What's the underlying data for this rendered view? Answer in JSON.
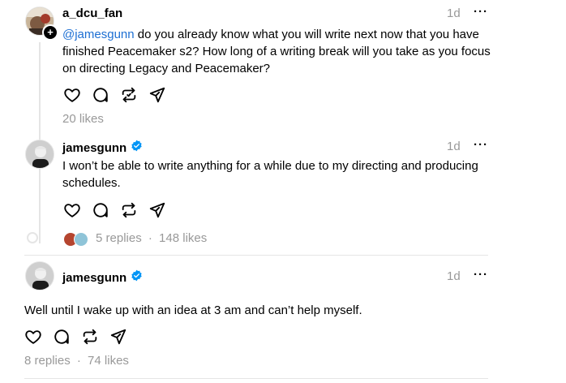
{
  "posts": [
    {
      "username": "a_dcu_fan",
      "time": "1d",
      "more": "···",
      "mention": "@jamesgunn",
      "text": "do you already know what you will write next now that you have finished Peacemaker s2? How long of a writing break will you take as you focus on directing Legacy and Peacemaker?",
      "likes": "20 likes"
    },
    {
      "username": "jamesgunn",
      "verified": true,
      "time": "1d",
      "more": "···",
      "text": "I won’t be able to write anything for a while due to my directing and producing schedules.",
      "replies": "5 replies",
      "sep": "·",
      "likes": "148 likes"
    },
    {
      "username": "jamesgunn",
      "verified": true,
      "time": "1d",
      "more": "···",
      "text": "Well until I wake up with an idea at 3 am and can’t help myself.",
      "replies": "8 replies",
      "sep": "·",
      "likes": "74 likes"
    }
  ],
  "icons": {
    "like": "heart-icon",
    "reply": "comment-icon",
    "repost": "repost-icon",
    "share": "send-icon"
  },
  "colors": {
    "mention": "#1d6fd3",
    "verified": "#0095f6",
    "muted": "#999999"
  }
}
